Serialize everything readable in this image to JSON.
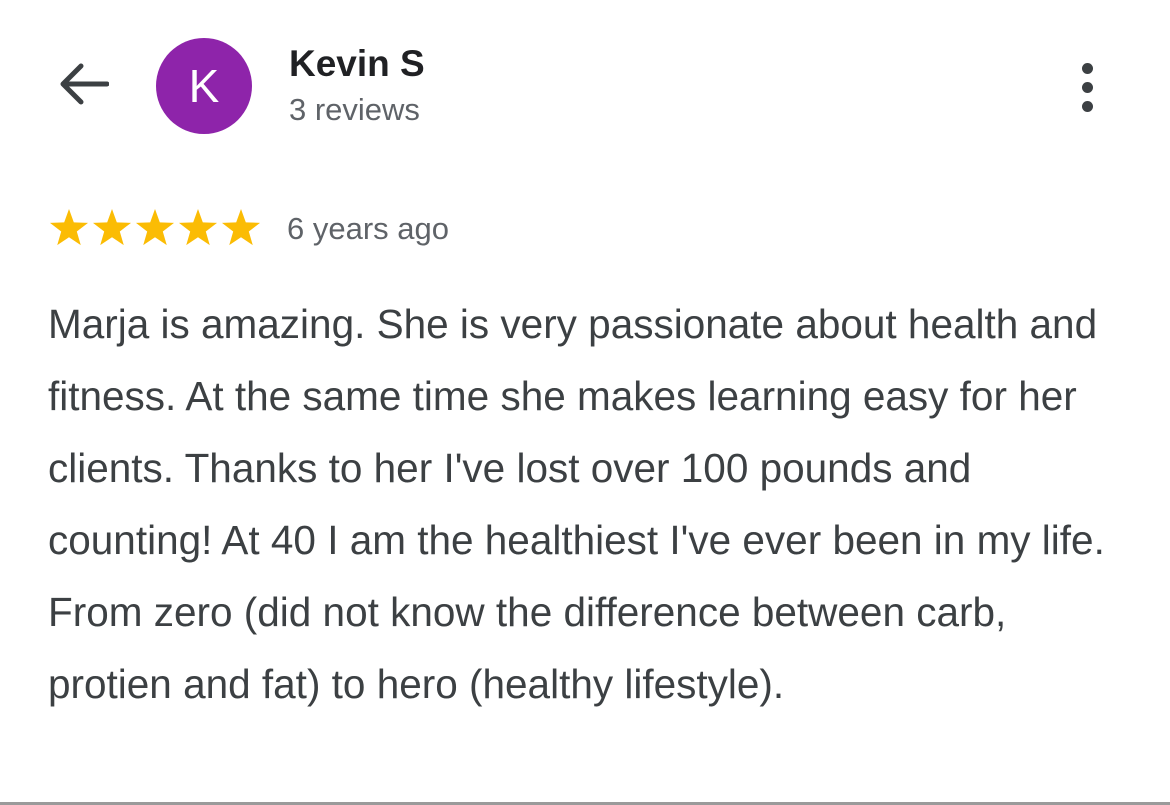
{
  "header": {
    "back_icon": "arrow-back-icon",
    "avatar_letter": "K",
    "user_name": "Kevin S",
    "review_count": "3 reviews",
    "more_icon": "more-vert-icon"
  },
  "review": {
    "rating": 5,
    "max_rating": 5,
    "star_icon": "star-icon",
    "time_ago": "6 years ago",
    "text": "Marja is amazing. She is very passionate about health and fitness. At the same time she makes learning easy for her clients. Thanks to her I've lost over 100 pounds and counting! At 40 I am the healthiest I've ever been in my life. From zero (did not know the difference between carb, protien and fat) to hero (healthy lifestyle)."
  },
  "colors": {
    "avatar_background": "#8e24aa",
    "star_fill": "#fbbc04",
    "name_text": "#202124",
    "secondary_text": "#5f6368",
    "body_text": "#3c4043"
  }
}
